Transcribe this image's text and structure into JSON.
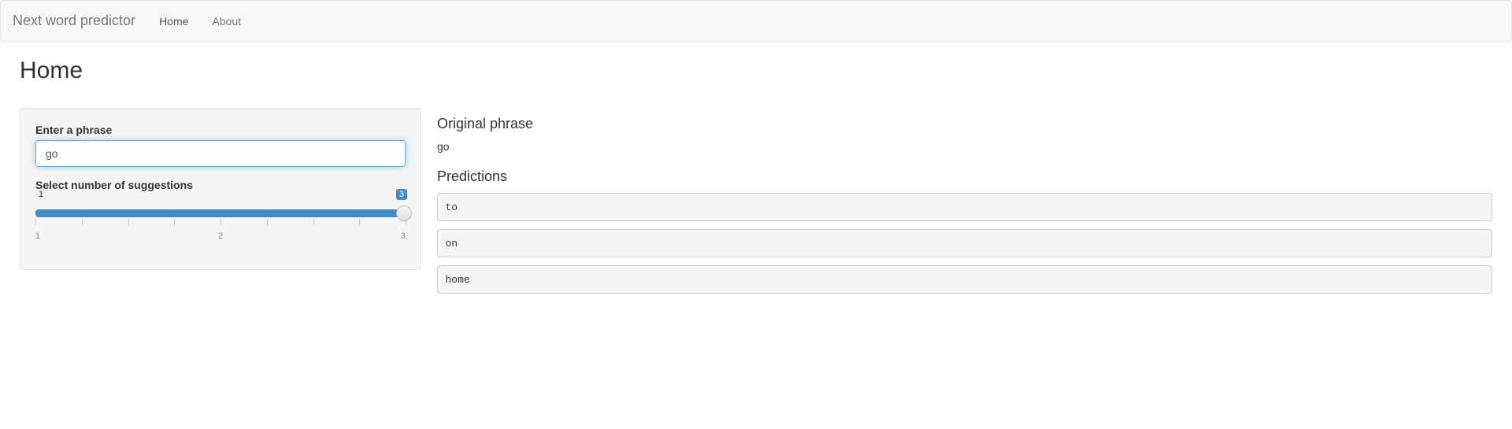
{
  "navbar": {
    "brand": "Next word predictor",
    "items": [
      {
        "label": "Home",
        "active": true
      },
      {
        "label": "About",
        "active": false
      }
    ]
  },
  "page_title": "Home",
  "sidebar": {
    "phrase_label": "Enter a phrase",
    "phrase_value": "go",
    "slider_label": "Select number of suggestions",
    "slider_min": "1",
    "slider_max": "3",
    "slider_mid": "2",
    "slider_value": "3"
  },
  "main": {
    "original_label": "Original phrase",
    "original_value": "go",
    "predictions_label": "Predictions",
    "predictions": [
      {
        "text": "to"
      },
      {
        "text": "on"
      },
      {
        "text": "home"
      }
    ]
  }
}
